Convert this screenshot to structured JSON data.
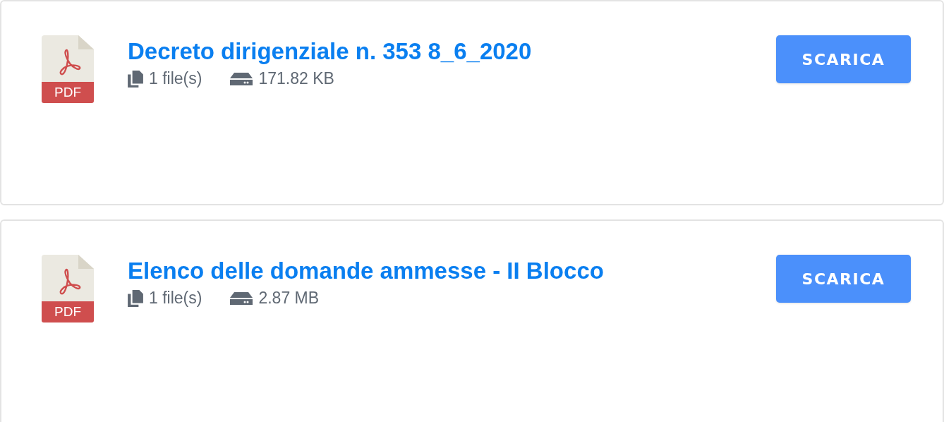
{
  "documents": [
    {
      "icon_label": "PDF",
      "title": "Decreto dirigenziale n. 353 8_6_2020",
      "files": "1 file(s)",
      "size": "171.82 KB",
      "button": "SCARICA"
    },
    {
      "icon_label": "PDF",
      "title": "Elenco delle domande ammesse - II Blocco",
      "files": "1 file(s)",
      "size": "2.87 MB",
      "button": "SCARICA"
    }
  ]
}
